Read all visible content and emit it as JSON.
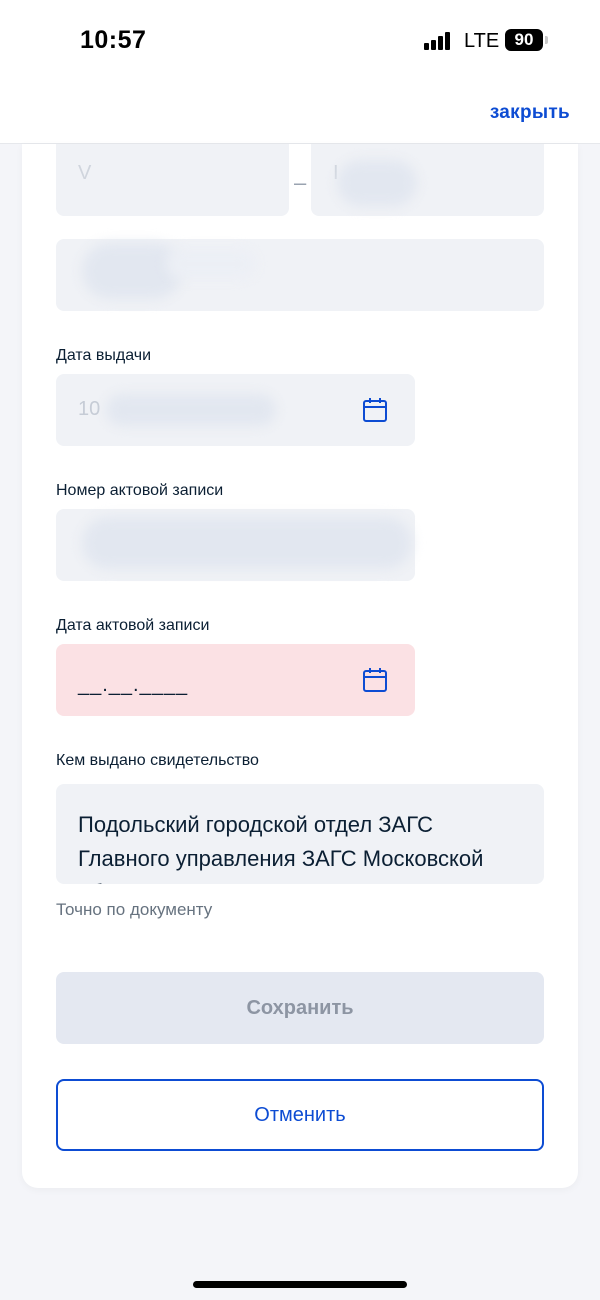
{
  "status_bar": {
    "time": "10:57",
    "network": "LTE",
    "battery": "90"
  },
  "header": {
    "close_label": "закрыть"
  },
  "form": {
    "series_field": {
      "value": "V"
    },
    "dash": "–",
    "number_field": {
      "value": "I"
    },
    "issue_date": {
      "label": "Дата выдачи",
      "value": "10"
    },
    "record_number": {
      "label": "Номер актовой записи",
      "value": ""
    },
    "record_date": {
      "label": "Дата актовой записи",
      "value": "__.__.____"
    },
    "issued_by": {
      "label": "Кем выдано свидетельство",
      "value": "Подольский городской отдел ЗАГС Главного управления ЗАГС Московской области",
      "hint": "Точно по документу"
    }
  },
  "buttons": {
    "save": "Сохранить",
    "cancel": "Отменить"
  },
  "colors": {
    "accent": "#0d4cd3",
    "error_bg": "#fbe1e4",
    "field_bg": "#f0f2f6"
  }
}
